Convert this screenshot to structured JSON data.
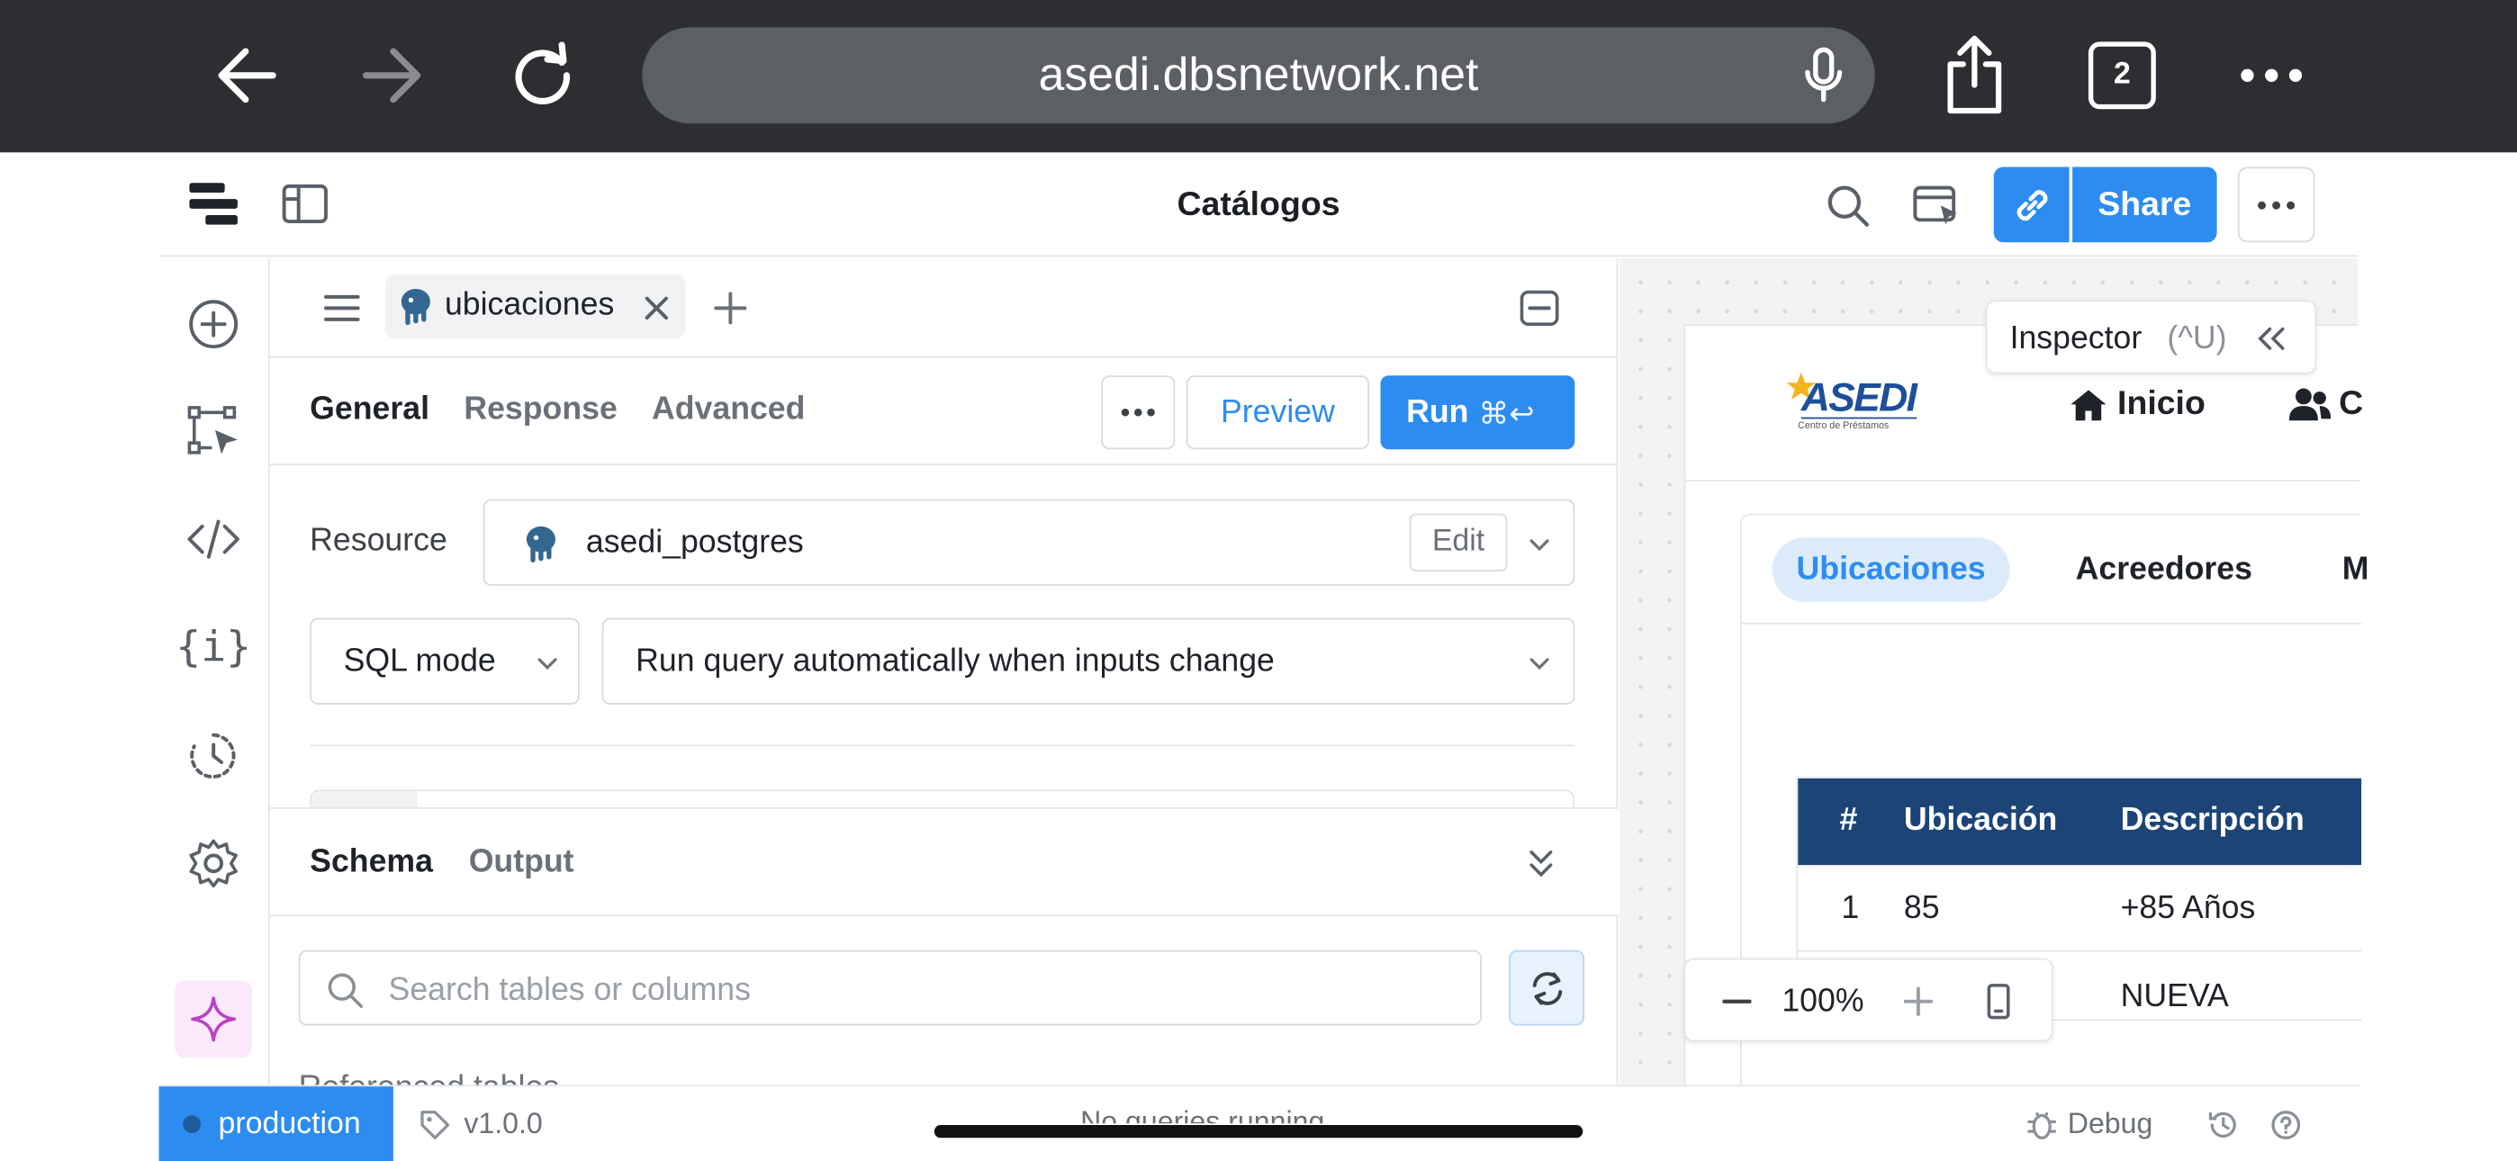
{
  "browser": {
    "url": "asedi.dbsnetwork.net",
    "tab_count": "2",
    "back_icon": "arrow-left-icon",
    "forward_icon": "arrow-right-icon",
    "reload_icon": "reload-icon",
    "mic_icon": "microphone-icon",
    "share_icon": "share-icon",
    "more_icon": "ellipsis-icon"
  },
  "app": {
    "title": "Catálogos",
    "share_label": "Share",
    "accent": "#2d8cf0"
  },
  "editor": {
    "tab_label": "ubicaciones",
    "subtabs": [
      "General",
      "Response",
      "Advanced"
    ],
    "preview_label": "Preview",
    "run_label": "Run",
    "run_shortcut": "⌘↩",
    "resource_label": "Resource",
    "resource_value": "asedi_postgres",
    "edit_label": "Edit",
    "mode_value": "SQL mode",
    "trigger_value": "Run query automatically when inputs change",
    "schema_tabs": [
      "Schema",
      "Output"
    ],
    "search_placeholder": "Search tables or columns",
    "partial_label": "Referenced tables"
  },
  "canvas": {
    "inspector_label": "Inspector",
    "inspector_shortcut": "(^U)",
    "logo_text": "ASEDI",
    "logo_sub": "Centro de Préstamos",
    "nav_home": "Inicio",
    "nav_partial": "C",
    "tabs": [
      "Ubicaciones",
      "Acreedores",
      "M"
    ],
    "table_headers": [
      "#",
      "Ubicación",
      "Descripción"
    ],
    "rows": [
      [
        "1",
        "85",
        "+85 Años"
      ],
      [
        "",
        "",
        "NUEVA"
      ]
    ],
    "zoom": "100%",
    "header_color": "#1d4477"
  },
  "status": {
    "env": "production",
    "version": "v1.0.0",
    "queries": "No queries running",
    "debug": "Debug"
  }
}
